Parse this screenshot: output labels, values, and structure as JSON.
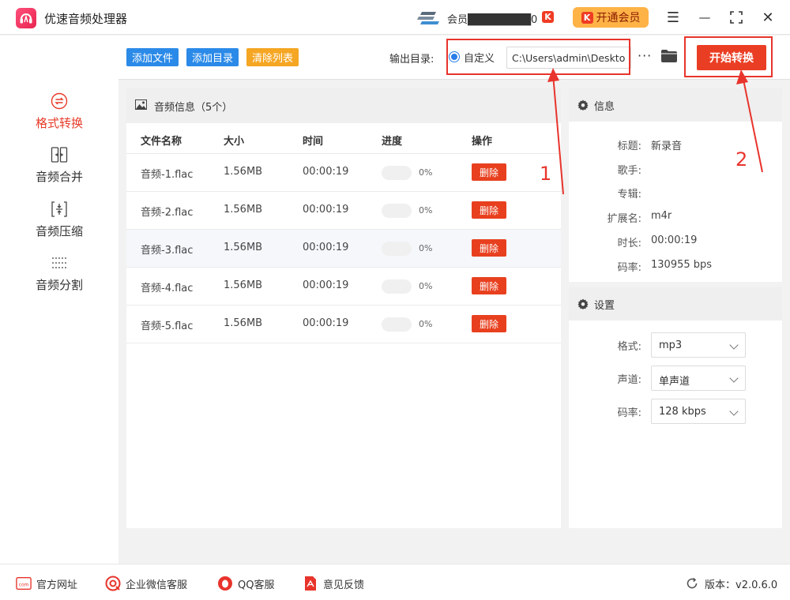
{
  "app": {
    "title": "优速音频处理器",
    "member_text": "会员████████0",
    "vip_label": "开通会员",
    "k_glyph": "K"
  },
  "window": {
    "menu_glyph": "☰",
    "minimize_glyph": "—",
    "maximize_glyph": "⛶",
    "close_glyph": "✕"
  },
  "sidebar": {
    "items": [
      {
        "label": "格式转换",
        "icon": "format-convert-icon",
        "active": true
      },
      {
        "label": "音频合并",
        "icon": "merge-icon",
        "active": false
      },
      {
        "label": "音频压缩",
        "icon": "compress-icon",
        "active": false
      },
      {
        "label": "音频分割",
        "icon": "split-icon",
        "active": false
      }
    ]
  },
  "toolbar": {
    "add_file": "添加文件",
    "add_folder": "添加目录",
    "clear_list": "清除列表",
    "output_label": "输出目录:",
    "custom_label": "自定义",
    "output_path": "C:\\Users\\admin\\Desktop",
    "more": "···",
    "start": "开始转换"
  },
  "file_panel": {
    "title": "音频信息（5个）",
    "columns": [
      "文件名称",
      "大小",
      "时间",
      "进度",
      "操作"
    ],
    "rows": [
      {
        "name": "音频-1.flac",
        "size": "1.56MB",
        "time": "00:00:19",
        "progress": 0,
        "progress_text": "0%",
        "action": "删除"
      },
      {
        "name": "音频-2.flac",
        "size": "1.56MB",
        "time": "00:00:19",
        "progress": 0,
        "progress_text": "0%",
        "action": "删除"
      },
      {
        "name": "音频-3.flac",
        "size": "1.56MB",
        "time": "00:00:19",
        "progress": 0,
        "progress_text": "0%",
        "action": "删除"
      },
      {
        "name": "音频-4.flac",
        "size": "1.56MB",
        "time": "00:00:19",
        "progress": 0,
        "progress_text": "0%",
        "action": "删除"
      },
      {
        "name": "音频-5.flac",
        "size": "1.56MB",
        "time": "00:00:19",
        "progress": 0,
        "progress_text": "0%",
        "action": "删除"
      }
    ]
  },
  "info": {
    "title": "信息",
    "fields": [
      {
        "label": "标题:",
        "value": "新录音"
      },
      {
        "label": "歌手:",
        "value": ""
      },
      {
        "label": "专辑:",
        "value": ""
      },
      {
        "label": "扩展名:",
        "value": "m4r"
      },
      {
        "label": "时长:",
        "value": "00:00:19"
      },
      {
        "label": "码率:",
        "value": "130955 bps"
      }
    ]
  },
  "settings": {
    "title": "设置",
    "format_label": "格式:",
    "format_value": "mp3",
    "channel_label": "声道:",
    "channel_value": "单声道",
    "bitrate_label": "码率:",
    "bitrate_value": "128 kbps"
  },
  "footer": {
    "website": "官方网址",
    "wechat": "企业微信客服",
    "qq": "QQ客服",
    "feedback": "意见反馈",
    "version": "版本：v2.0.6.0"
  },
  "annotations": {
    "one": "1",
    "two": "2"
  },
  "colors": {
    "accent": "#e73b28",
    "blue_button": "#2b8ae8",
    "orange_button": "#f5a623",
    "start_button": "#ea3e24",
    "annotation": "#e8342c"
  }
}
